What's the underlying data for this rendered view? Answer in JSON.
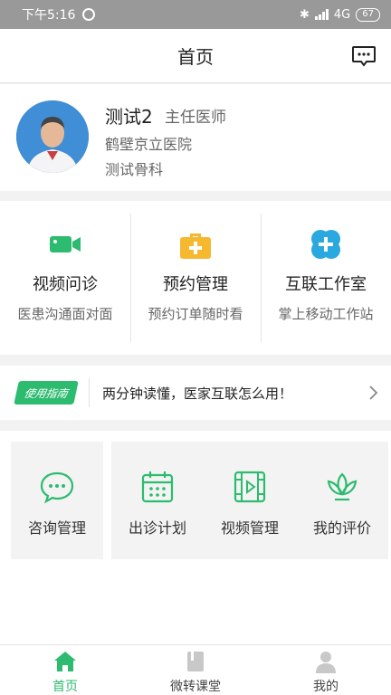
{
  "status_bar": {
    "time": "下午5:16",
    "network": "4G",
    "battery": "67"
  },
  "header": {
    "title": "首页"
  },
  "profile": {
    "name": "测试2",
    "title": "主任医师",
    "hospital": "鹤壁京立医院",
    "department": "测试骨科"
  },
  "services": [
    {
      "label": "视频问诊",
      "desc": "医患沟通面对面",
      "icon": "video-camera-icon"
    },
    {
      "label": "预约管理",
      "desc": "预约订单随时看",
      "icon": "medical-kit-icon"
    },
    {
      "label": "互联工作室",
      "desc": "掌上移动工作站",
      "icon": "clover-cross-icon"
    }
  ],
  "guide": {
    "badge": "使用指南",
    "text": "两分钟读懂，医家互联怎么用！"
  },
  "tools": [
    {
      "label": "咨询管理",
      "icon": "chat-bubble-icon"
    },
    {
      "label": "出诊计划",
      "icon": "calendar-icon"
    },
    {
      "label": "视频管理",
      "icon": "film-play-icon"
    },
    {
      "label": "我的评价",
      "icon": "lotus-icon"
    }
  ],
  "tabs": [
    {
      "label": "首页",
      "icon": "home-icon",
      "active": true
    },
    {
      "label": "微转课堂",
      "icon": "book-icon",
      "active": false
    },
    {
      "label": "我的",
      "icon": "person-icon",
      "active": false
    }
  ],
  "colors": {
    "accent": "#2dbb6f",
    "service_icon_yellow": "#f5b82e",
    "service_icon_blue": "#2aa8e0"
  }
}
